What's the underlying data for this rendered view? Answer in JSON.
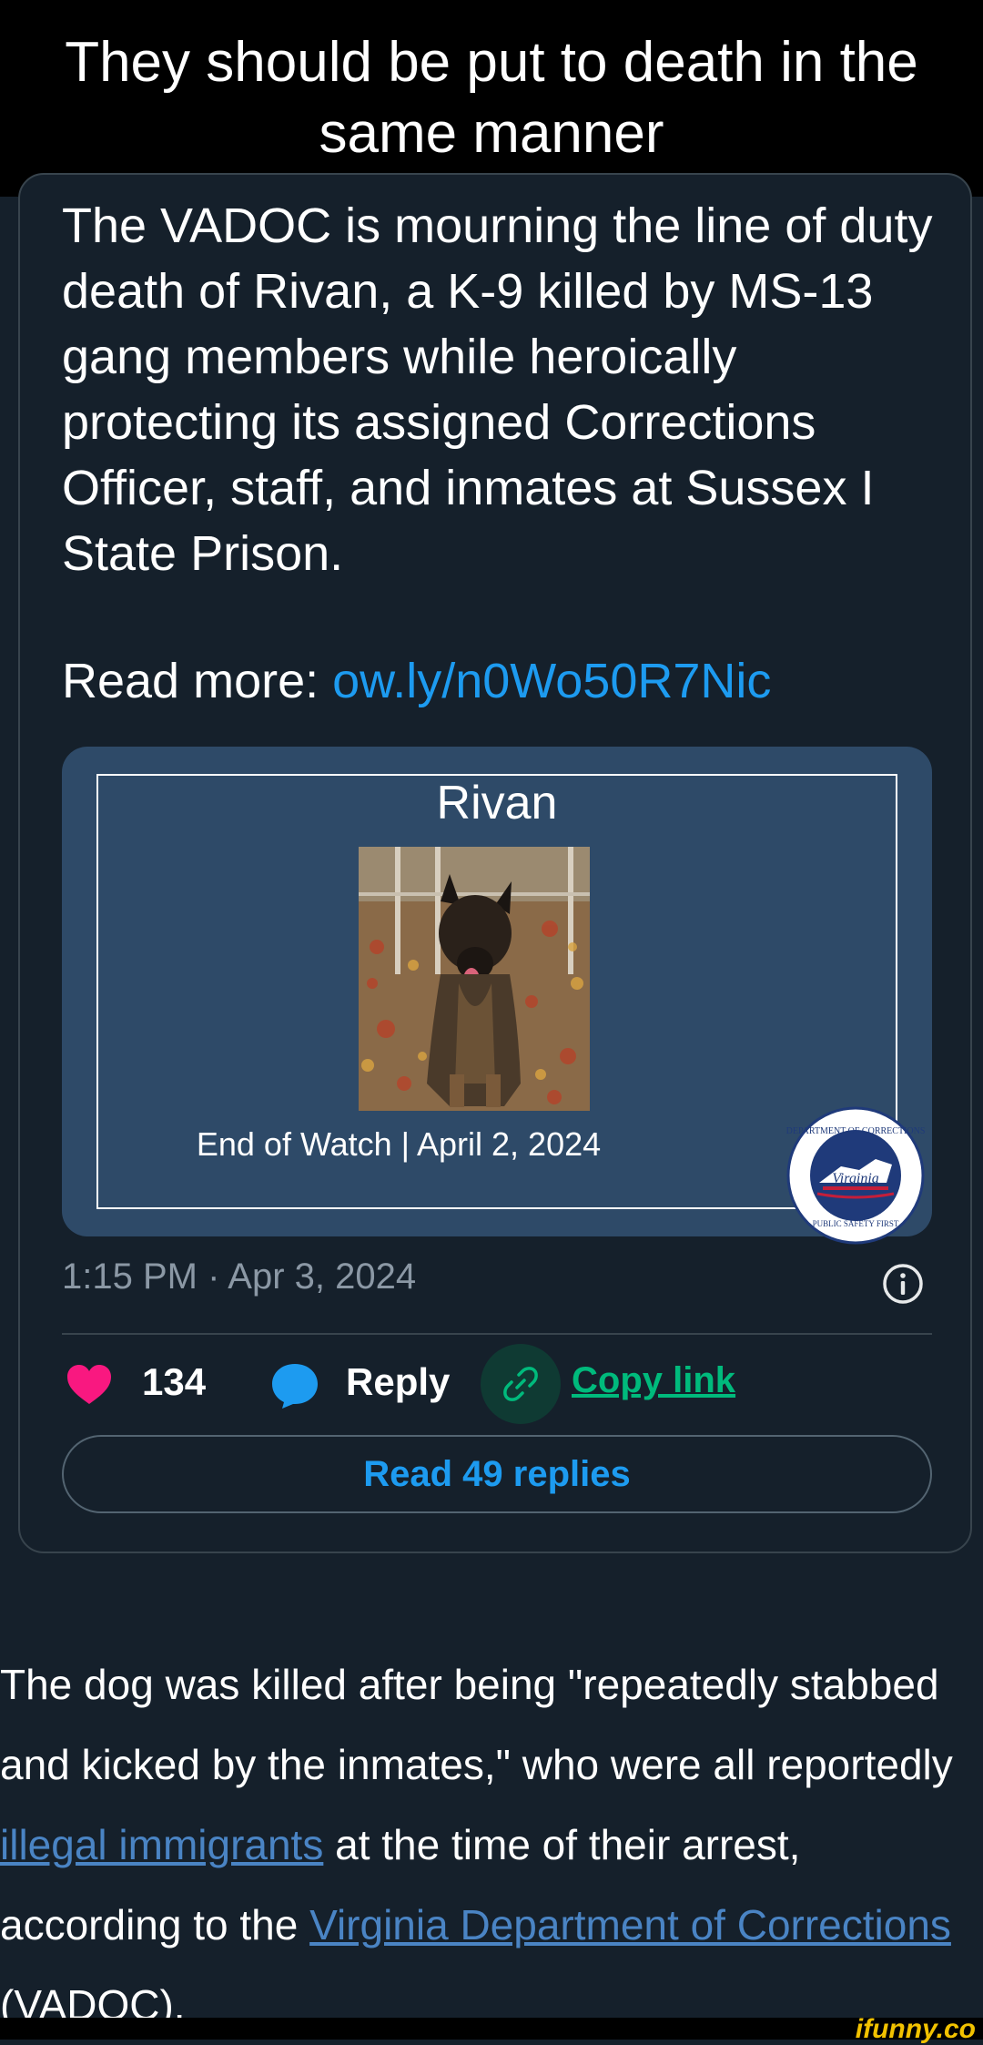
{
  "caption": "They should be put to death in the same manner",
  "tweet": {
    "text": "The VADOC is mourning the line of duty death of Rivan, a K-9 killed by MS-13 gang members while heroically protecting its assigned Corrections Officer, staff, and inmates at Sussex I State Prison.",
    "read_more_label": "Read more: ",
    "read_more_link": "ow.ly/n0Wo50R7Nic",
    "media": {
      "name": "Rivan",
      "end_of_watch": "End of Watch | April 2, 2024",
      "seal_top": "DEPARTMENT OF CORRECTIONS",
      "seal_middle": "Virginia",
      "seal_bottom": "PUBLIC SAFETY FIRST"
    },
    "timestamp": "1:15 PM · Apr 3, 2024",
    "likes": "134",
    "reply_label": "Reply",
    "copy_link_label": "Copy link",
    "read_replies_label": "Read 49 replies"
  },
  "article": {
    "p1": "The dog was killed after being \"repeatedly stabbed and kicked by the inmates,\" who were all reportedly ",
    "link1": "illegal immigrants",
    "p2": " at the time of their arrest, according to the ",
    "link2": "Virginia Department of Corrections",
    "p3": " (VADOC)."
  },
  "watermark": "ifunny.co",
  "colors": {
    "background": "#15202b",
    "link": "#1d9bf0",
    "like": "#f91880",
    "copy": "#00ba7c",
    "article_link": "#4a84c4"
  }
}
